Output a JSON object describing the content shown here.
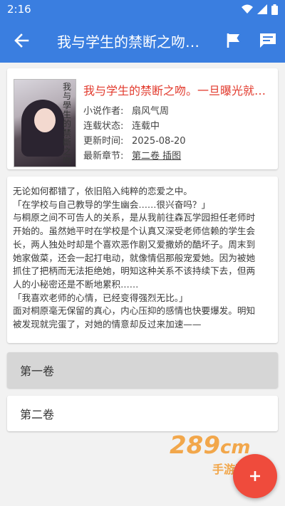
{
  "status_bar": {
    "time": "2:16"
  },
  "app_bar": {
    "title": "我与学生的禁断之吻。一旦曝光…"
  },
  "book": {
    "title": "我与学生的禁断之吻。一旦曝光就完蛋了",
    "cover_text": "我与學生的禁斷之吻",
    "author_label": "小说作者:",
    "author": "扇风气周",
    "status_label": "连载状态:",
    "status": "连载中",
    "updated_label": "更新时间:",
    "updated": "2025-08-20",
    "latest_label": "最新章节:",
    "latest": "第二卷 插图"
  },
  "description": [
    "无论如何都错了，依旧陷入纯粹的恋爱之中。",
    "「在学校与自己教导的学生幽会……很兴奋吗？」",
    "与桐原之间不可告人的关系，是从我前往森瓦学园担任老师时",
    "开始的。虽然她平时在学校是个认真又深受老师信赖的学生会",
    "长，两人独处时却是个喜欢恶作剧又爱撒娇的酷坏子。周末到",
    "她家做菜，还会一起打电动，就像情侣那般宠爱她。因为被她",
    "抓住了把柄而无法拒绝她，明知这种关系不该持续下去，但两",
    "人的小秘密还是不断地累积……",
    "「我喜欢老师的心情，已经变得强烈无比。」",
    "面对桐原毫无保留的真心，内心压抑的感情也快要爆发。明知",
    "被发现就完蛋了，对她的情意却反过来加速——"
  ],
  "volumes": [
    {
      "label": "第一卷"
    },
    {
      "label": "第二卷"
    }
  ],
  "watermark": {
    "number": "289",
    "suffix": "cm",
    "sub": "手游网"
  },
  "fab": {
    "icon": "plus-icon"
  },
  "colors": {
    "primary": "#3a7ee0",
    "accent": "#ef4b3c",
    "title_red": "#e23b2e"
  }
}
